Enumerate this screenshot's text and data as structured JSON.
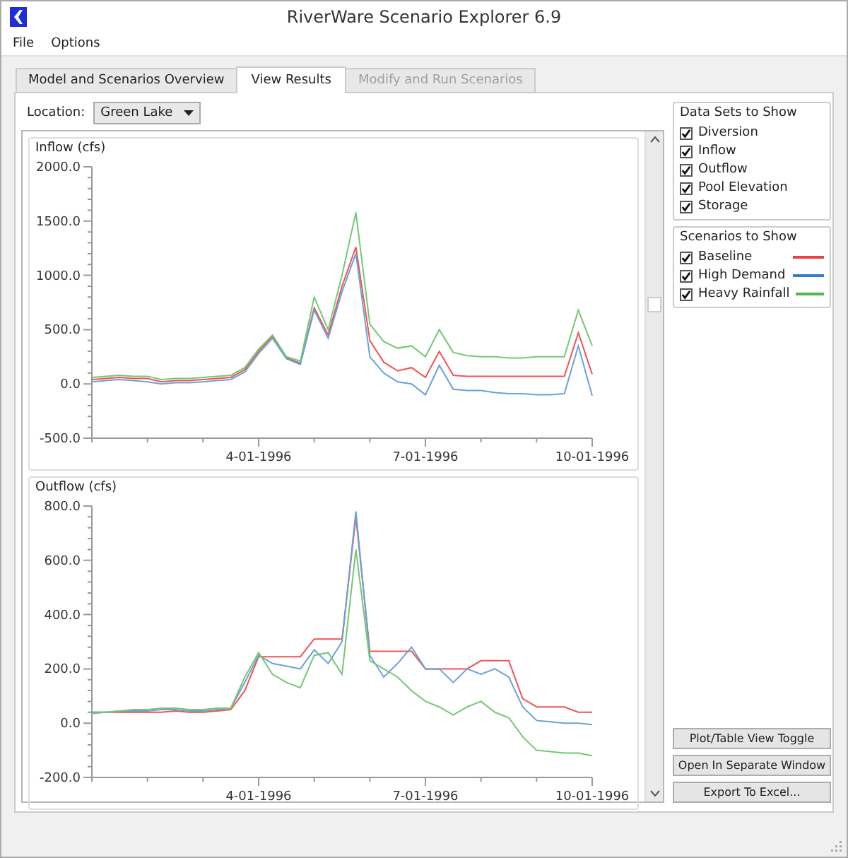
{
  "window": {
    "title": "RiverWare Scenario Explorer 6.9"
  },
  "menu": [
    "File",
    "Options"
  ],
  "tabs": [
    {
      "label": "Model and Scenarios Overview",
      "selected": false,
      "disabled": false
    },
    {
      "label": "View Results",
      "selected": true,
      "disabled": false
    },
    {
      "label": "Modify and Run Scenarios",
      "selected": false,
      "disabled": true
    }
  ],
  "location": {
    "label": "Location:",
    "value": "Green Lake"
  },
  "charts": [
    {
      "title": "Inflow (cfs)",
      "chart_data": {
        "type": "line",
        "categories": [
          null,
          null,
          null,
          null,
          null,
          null,
          null,
          null,
          null,
          null,
          null,
          null,
          "4-01-1996",
          null,
          null,
          null,
          null,
          null,
          null,
          null,
          null,
          null,
          null,
          null,
          "7-01-1996",
          null,
          null,
          null,
          null,
          null,
          null,
          null,
          null,
          null,
          null,
          null,
          "10-01-1996"
        ],
        "series": [
          {
            "color": "#f05454",
            "values": [
              40,
              50,
              60,
              50,
              50,
              20,
              30,
              30,
              40,
              50,
              60,
              130,
              300,
              440,
              240,
              190,
              700,
              450,
              900,
              1260,
              400,
              200,
              120,
              150,
              60,
              300,
              80,
              70,
              70,
              70,
              70,
              70,
              70,
              70,
              70,
              470,
              90
            ]
          },
          {
            "color": "#6aa2d8",
            "values": [
              20,
              30,
              40,
              30,
              20,
              0,
              10,
              10,
              20,
              30,
              40,
              110,
              280,
              420,
              230,
              180,
              680,
              420,
              850,
              1200,
              250,
              100,
              20,
              0,
              -100,
              170,
              -50,
              -60,
              -60,
              -80,
              -90,
              -90,
              -100,
              -100,
              -90,
              350,
              -110
            ]
          },
          {
            "color": "#74c874",
            "values": [
              60,
              70,
              80,
              70,
              70,
              40,
              50,
              50,
              60,
              70,
              80,
              150,
              320,
              450,
              250,
              210,
              800,
              500,
              1000,
              1580,
              550,
              390,
              330,
              350,
              250,
              500,
              290,
              260,
              250,
              250,
              240,
              240,
              250,
              250,
              250,
              680,
              350
            ]
          }
        ],
        "ylim": [
          -500,
          2000
        ],
        "yticks": [
          {
            "value": -500,
            "label": "-500.0"
          },
          {
            "value": 0,
            "label": "0.0"
          },
          {
            "value": 500,
            "label": "500.0"
          },
          {
            "value": 1000,
            "label": "1000.0"
          },
          {
            "value": 1500,
            "label": "1500.0"
          },
          {
            "value": 2000,
            "label": "2000.0"
          }
        ]
      }
    },
    {
      "title": "Outflow (cfs)",
      "chart_data": {
        "type": "line",
        "categories": [
          null,
          null,
          null,
          null,
          null,
          null,
          null,
          null,
          null,
          null,
          null,
          null,
          "4-01-1996",
          null,
          null,
          null,
          null,
          null,
          null,
          null,
          null,
          null,
          null,
          null,
          "7-01-1996",
          null,
          null,
          null,
          null,
          null,
          null,
          null,
          null,
          null,
          null,
          null,
          "10-01-1996"
        ],
        "series": [
          {
            "color": "#f05454",
            "values": [
              40,
              40,
              40,
              40,
              40,
              40,
              45,
              40,
              40,
              45,
              50,
              120,
              245,
              245,
              245,
              245,
              310,
              310,
              310,
              760,
              265,
              265,
              265,
              265,
              200,
              200,
              200,
              200,
              230,
              230,
              230,
              90,
              60,
              60,
              60,
              40,
              40
            ]
          },
          {
            "color": "#6aa2d8",
            "values": [
              40,
              40,
              45,
              45,
              45,
              50,
              50,
              45,
              45,
              50,
              55,
              150,
              250,
              220,
              210,
              200,
              270,
              220,
              300,
              780,
              250,
              170,
              220,
              280,
              200,
              200,
              150,
              200,
              180,
              200,
              170,
              60,
              10,
              5,
              0,
              0,
              -5
            ]
          },
          {
            "color": "#74c874",
            "values": [
              35,
              40,
              45,
              50,
              50,
              55,
              55,
              50,
              50,
              55,
              55,
              170,
              260,
              180,
              150,
              130,
              250,
              260,
              180,
              640,
              230,
              200,
              170,
              120,
              80,
              60,
              30,
              60,
              80,
              40,
              20,
              -50,
              -100,
              -105,
              -110,
              -110,
              -120
            ]
          }
        ],
        "ylim": [
          -200,
          800
        ],
        "yticks": [
          {
            "value": -200,
            "label": "-200.0"
          },
          {
            "value": 0,
            "label": "0.0"
          },
          {
            "value": 200,
            "label": "200.0"
          },
          {
            "value": 400,
            "label": "400.0"
          },
          {
            "value": 600,
            "label": "600.0"
          },
          {
            "value": 800,
            "label": "800.0"
          }
        ]
      }
    }
  ],
  "data_sets": {
    "title": "Data Sets to Show",
    "items": [
      {
        "label": "Diversion",
        "checked": true
      },
      {
        "label": "Inflow",
        "checked": true
      },
      {
        "label": "Outflow",
        "checked": true
      },
      {
        "label": "Pool Elevation",
        "checked": true
      },
      {
        "label": "Storage",
        "checked": true
      }
    ]
  },
  "scenarios": {
    "title": "Scenarios to Show",
    "items": [
      {
        "label": "Baseline",
        "checked": true,
        "color": "#e84343"
      },
      {
        "label": "High Demand",
        "checked": true,
        "color": "#2f7fd0"
      },
      {
        "label": "Heavy Rainfall",
        "checked": true,
        "color": "#4cbb4c"
      }
    ]
  },
  "buttons": [
    "Plot/Table View Toggle",
    "Open In Separate Window",
    "Export To Excel..."
  ]
}
